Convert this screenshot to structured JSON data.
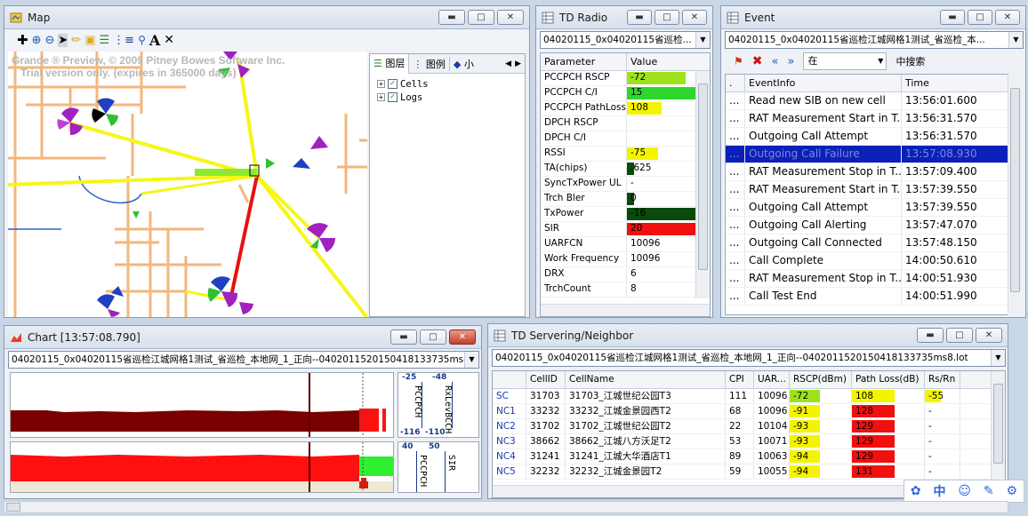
{
  "map": {
    "title": "Map",
    "watermark1": "Grande ® Preview, © 2009 Pitney Bowes Software Inc.",
    "watermark2": "Trial version only. (expires in 365000 days)",
    "layer_tabs": [
      "图层",
      "图例",
      "小"
    ],
    "tree": [
      "Cells",
      "Logs"
    ]
  },
  "td_radio": {
    "title": "TD Radio",
    "combo": "04020115_0x04020115省巡检...",
    "headers": [
      "Parameter",
      "Value"
    ],
    "rows": [
      {
        "p": "PCCPCH RSCP",
        "v": "-72",
        "fill": 0.85,
        "color": "#9ee21c"
      },
      {
        "p": "PCCPCH C/I",
        "v": "15",
        "fill": 1.0,
        "color": "#2ed62e"
      },
      {
        "p": "PCCPCH PathLoss",
        "v": "108",
        "fill": 0.5,
        "color": "#f4f400"
      },
      {
        "p": "DPCH RSCP",
        "v": "",
        "fill": 0,
        "color": "#ffffff"
      },
      {
        "p": "DPCH C/I",
        "v": "",
        "fill": 0,
        "color": "#ffffff"
      },
      {
        "p": "RSSI",
        "v": "-75",
        "fill": 0.45,
        "color": "#f4f400"
      },
      {
        "p": "TA(chips)",
        "v": ".625",
        "fill": 0.1,
        "color": "#0a4a0a"
      },
      {
        "p": "SyncTxPower UL",
        "v": "-",
        "fill": 0,
        "color": "#ffffff"
      },
      {
        "p": "Trch Bler",
        "v": "0",
        "fill": 0.1,
        "color": "#0a4a0a"
      },
      {
        "p": "TxPower",
        "v": "-16",
        "fill": 1.0,
        "color": "#0a4a0a"
      },
      {
        "p": "SIR",
        "v": "20",
        "fill": 1.0,
        "color": "#f01010"
      },
      {
        "p": "UARFCN",
        "v": "10096",
        "fill": 0,
        "color": "#ffffff"
      },
      {
        "p": "Work Frequency",
        "v": "10096",
        "fill": 0,
        "color": "#ffffff"
      },
      {
        "p": "DRX",
        "v": "6",
        "fill": 0,
        "color": "#ffffff"
      },
      {
        "p": "TrchCount",
        "v": "8",
        "fill": 0,
        "color": "#ffffff"
      }
    ]
  },
  "event": {
    "title": "Event",
    "combo": "04020115_0x04020115省巡检江城网格1测试_省巡检_本...",
    "search_in": "在",
    "search_btn": "中搜索",
    "headers": [
      ".",
      "EventInfo",
      "Time"
    ],
    "rows": [
      {
        "info": "Read new SIB on new cell",
        "time": "13:56:01.600"
      },
      {
        "info": "RAT Measurement Start in T...",
        "time": "13:56:31.570"
      },
      {
        "info": "Outgoing Call Attempt",
        "time": "13:56:31.570"
      },
      {
        "info": "Outgoing Call Failure",
        "time": "13:57:08.930"
      },
      {
        "info": "RAT Measurement Stop in T...",
        "time": "13:57:09.400"
      },
      {
        "info": "RAT Measurement Start in T...",
        "time": "13:57:39.550"
      },
      {
        "info": "Outgoing Call Attempt",
        "time": "13:57:39.550"
      },
      {
        "info": "Outgoing Call Alerting",
        "time": "13:57:47.070"
      },
      {
        "info": "Outgoing Call Connected",
        "time": "13:57:48.150"
      },
      {
        "info": "Call Complete",
        "time": "14:00:50.610"
      },
      {
        "info": "RAT Measurement Stop in T...",
        "time": "14:00:51.930"
      },
      {
        "info": "Call Test End",
        "time": "14:00:51.990"
      }
    ],
    "selected_index": 3,
    "dots": "..."
  },
  "chart": {
    "title": "Chart [13:57:08.790]",
    "combo": "04020115_0x04020115省巡检江城网格1测试_省巡检_本地网_1_正向--0402011520150418133735ms8.lot",
    "panel1": {
      "top": "-25",
      "top2": "-48",
      "bottom": "-116",
      "bottom2": "-110",
      "label1": "PCCPCH",
      "label2": "RxLevBCCH"
    },
    "panel2": {
      "top": "40",
      "top2": "50",
      "label1": "PCCPCH",
      "label2": "SIR"
    }
  },
  "servering": {
    "title": "TD Servering/Neighbor",
    "combo": "04020115_0x04020115省巡检江城网格1测试_省巡检_本地网_1_正向--0402011520150418133735ms8.lot",
    "headers": [
      "",
      "CellID",
      "CellName",
      "CPI",
      "UAR...",
      "RSCP(dBm)",
      "Path Loss(dB)",
      "Rs/Rn"
    ],
    "rows": [
      {
        "type": "SC",
        "id": "31703",
        "name": "31703_江城世纪公园T3",
        "cpi": "111",
        "uar": "10096",
        "rscp": "-72",
        "rscp_color": "#9ee21c",
        "pl": "108",
        "pl_color": "#f4f400",
        "rs": "-55",
        "rs_color": "#f4f400"
      },
      {
        "type": "NC1",
        "id": "33232",
        "name": "33232_江城金景园西T2",
        "cpi": "68",
        "uar": "10096",
        "rscp": "-91",
        "rscp_color": "#f4f400",
        "pl": "128",
        "pl_color": "#f01010",
        "rs": "-",
        "rs_color": ""
      },
      {
        "type": "NC2",
        "id": "31702",
        "name": "31702_江城世纪公园T2",
        "cpi": "22",
        "uar": "10104",
        "rscp": "-93",
        "rscp_color": "#f4f400",
        "pl": "129",
        "pl_color": "#f01010",
        "rs": "-",
        "rs_color": ""
      },
      {
        "type": "NC3",
        "id": "38662",
        "name": "38662_江城八方沃足T2",
        "cpi": "53",
        "uar": "10071",
        "rscp": "-93",
        "rscp_color": "#f4f400",
        "pl": "129",
        "pl_color": "#f01010",
        "rs": "-",
        "rs_color": ""
      },
      {
        "type": "NC4",
        "id": "31241",
        "name": "31241_江城大华酒店T1",
        "cpi": "89",
        "uar": "10063",
        "rscp": "-94",
        "rscp_color": "#f4f400",
        "pl": "129",
        "pl_color": "#f01010",
        "rs": "-",
        "rs_color": ""
      },
      {
        "type": "NC5",
        "id": "32232",
        "name": "32232_江城金景园T2",
        "cpi": "59",
        "uar": "10055",
        "rscp": "-94",
        "rscp_color": "#f4f400",
        "pl": "131",
        "pl_color": "#f01010",
        "rs": "-",
        "rs_color": ""
      }
    ]
  },
  "ime": {
    "lang": "中"
  }
}
